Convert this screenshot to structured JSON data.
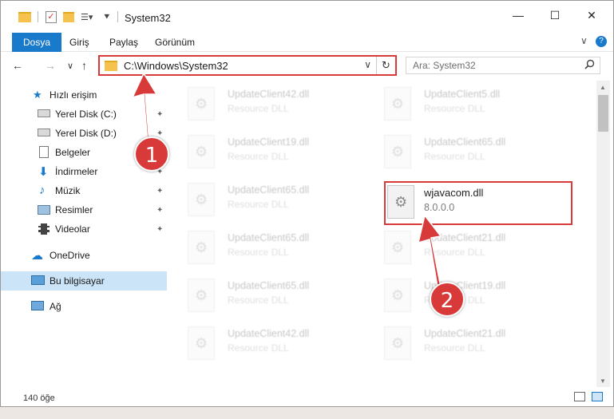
{
  "window": {
    "title": "System32",
    "controls": {
      "minimize": "—",
      "maximize": "☐",
      "close": "✕"
    }
  },
  "ribbon": {
    "tabs": [
      "Dosya",
      "Giriş",
      "Paylaş",
      "Görünüm"
    ],
    "expand": "∨",
    "help": "?"
  },
  "nav": {
    "back": "←",
    "forward": "→",
    "recent": "∨",
    "up": "↑",
    "address": "C:\\Windows\\System32",
    "dropdown": "∨",
    "refresh": "↻",
    "search_placeholder": "Ara: System32",
    "search_icon": "🔍"
  },
  "sidebar": {
    "quick_access": "Hızlı erişim",
    "items": [
      {
        "label": "Yerel Disk (C:)",
        "pinned": "📌"
      },
      {
        "label": "Yerel Disk (D:)",
        "pinned": "📌"
      },
      {
        "label": "Belgeler",
        "pinned": "📌"
      },
      {
        "label": "İndirmeler",
        "pinned": "📌"
      },
      {
        "label": "Müzik",
        "pinned": "📌"
      },
      {
        "label": "Resimler",
        "pinned": "📌"
      },
      {
        "label": "Videolar",
        "pinned": "📌"
      }
    ],
    "onedrive": "OneDrive",
    "this_pc": "Bu bilgisayar",
    "network": "Ağ"
  },
  "files": {
    "left_column": [
      {
        "name": "UpdateClient42.dll",
        "type": "Resource DLL"
      },
      {
        "name": "UpdateClient19.dll",
        "type": "Resource DLL"
      },
      {
        "name": "UpdateClient65.dll",
        "type": "Resource DLL"
      },
      {
        "name": "UpdateClient65.dll",
        "type": "Resource DLL"
      },
      {
        "name": "UpdateClient65.dll",
        "type": "Resource DLL"
      },
      {
        "name": "UpdateClient42.dll",
        "type": "Resource DLL"
      }
    ],
    "right_column": [
      {
        "name": "UpdateClient5.dll",
        "type": "Resource DLL"
      },
      {
        "name": "UpdateClient65.dll",
        "type": "Resource DLL"
      },
      {
        "name": "wjavacom.dll",
        "type": "8.0.0.0"
      },
      {
        "name": "UpdateClient21.dll",
        "type": "Resource DLL"
      },
      {
        "name": "UpdateClient19.dll",
        "type": "Resource DLL"
      },
      {
        "name": "UpdateClient21.dll",
        "type": "Resource DLL"
      }
    ]
  },
  "status": {
    "count": "140 öğe"
  },
  "annotations": {
    "step1": "1",
    "step2": "2",
    "color": "#d83a3a"
  }
}
